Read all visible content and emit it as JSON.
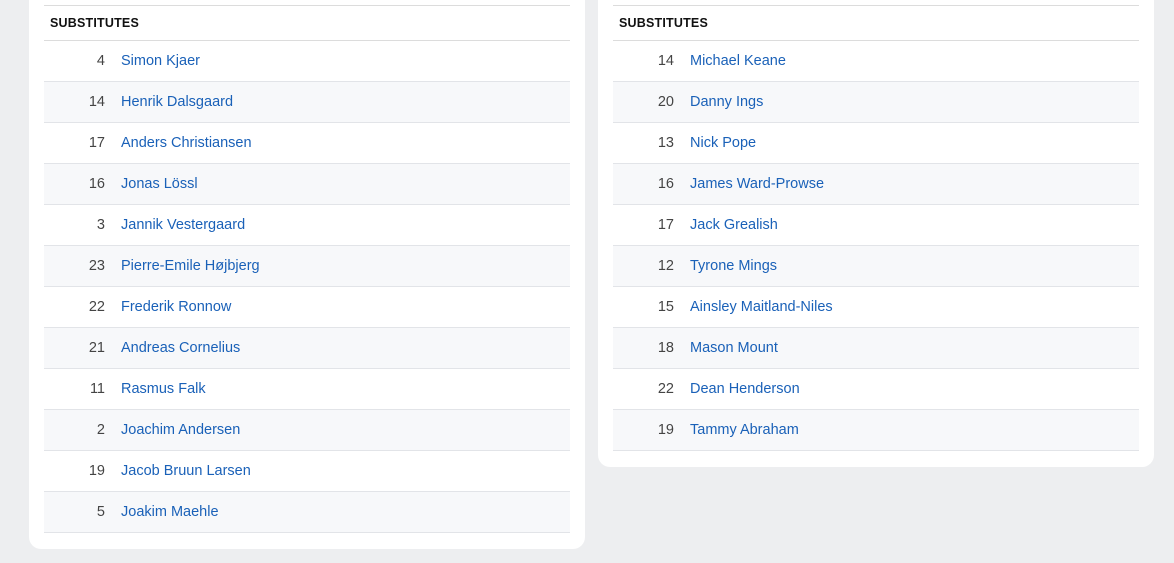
{
  "left_team": {
    "header": "SUBSTITUTES",
    "players": [
      {
        "number": "4",
        "name": "Simon Kjaer"
      },
      {
        "number": "14",
        "name": "Henrik Dalsgaard"
      },
      {
        "number": "17",
        "name": "Anders Christiansen"
      },
      {
        "number": "16",
        "name": "Jonas Lössl"
      },
      {
        "number": "3",
        "name": "Jannik Vestergaard"
      },
      {
        "number": "23",
        "name": "Pierre-Emile Højbjerg"
      },
      {
        "number": "22",
        "name": "Frederik Ronnow"
      },
      {
        "number": "21",
        "name": "Andreas Cornelius"
      },
      {
        "number": "11",
        "name": "Rasmus Falk"
      },
      {
        "number": "2",
        "name": "Joachim Andersen"
      },
      {
        "number": "19",
        "name": "Jacob Bruun Larsen"
      },
      {
        "number": "5",
        "name": "Joakim Maehle"
      }
    ]
  },
  "right_team": {
    "header": "SUBSTITUTES",
    "players": [
      {
        "number": "14",
        "name": "Michael Keane"
      },
      {
        "number": "20",
        "name": "Danny Ings"
      },
      {
        "number": "13",
        "name": "Nick Pope"
      },
      {
        "number": "16",
        "name": "James Ward-Prowse"
      },
      {
        "number": "17",
        "name": "Jack Grealish"
      },
      {
        "number": "12",
        "name": "Tyrone Mings"
      },
      {
        "number": "15",
        "name": "Ainsley Maitland-Niles"
      },
      {
        "number": "18",
        "name": "Mason Mount"
      },
      {
        "number": "22",
        "name": "Dean Henderson"
      },
      {
        "number": "19",
        "name": "Tammy Abraham"
      }
    ]
  },
  "colors": {
    "page_background": "#edeef0",
    "card_background": "#ffffff",
    "link": "#1a61b8",
    "number_text": "#444444",
    "stripe": "#f7f8fa"
  }
}
